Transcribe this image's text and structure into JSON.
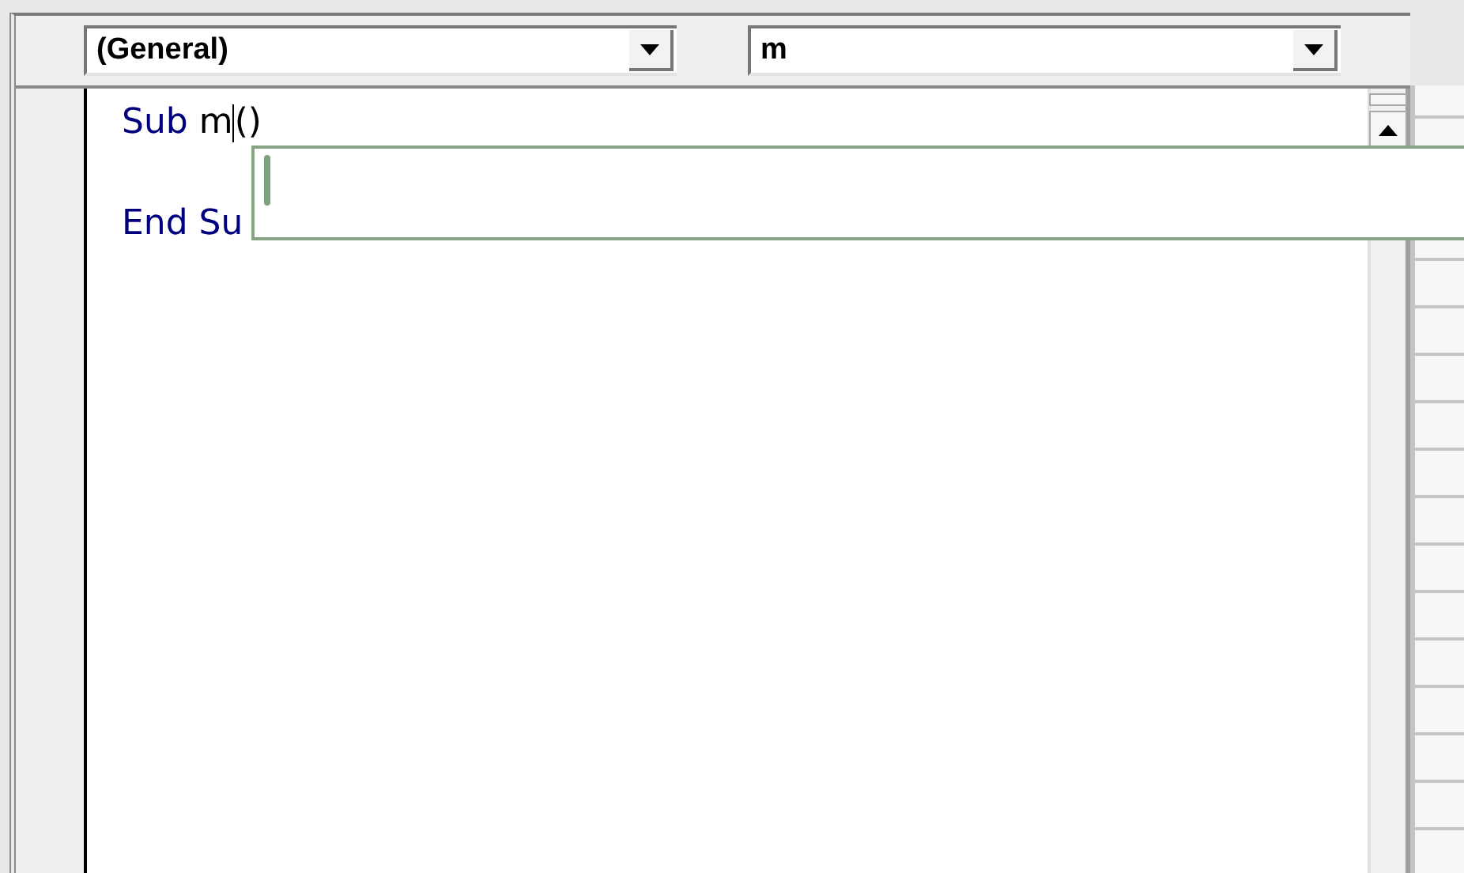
{
  "toolbar": {
    "object_combo": {
      "value": "(General)"
    },
    "procedure_combo": {
      "value": "m"
    }
  },
  "code_lines": [
    {
      "kind": "code",
      "tokens": [
        {
          "kind": "keyword",
          "text": "Sub"
        },
        {
          "kind": "plain",
          "text": " m"
        },
        {
          "kind": "caret"
        },
        {
          "kind": "plain",
          "text": "()"
        }
      ]
    },
    {
      "kind": "blank"
    },
    {
      "kind": "code",
      "tokens": [
        {
          "kind": "keyword",
          "text": "End Su"
        }
      ]
    }
  ],
  "autocomplete": {
    "open": true
  }
}
